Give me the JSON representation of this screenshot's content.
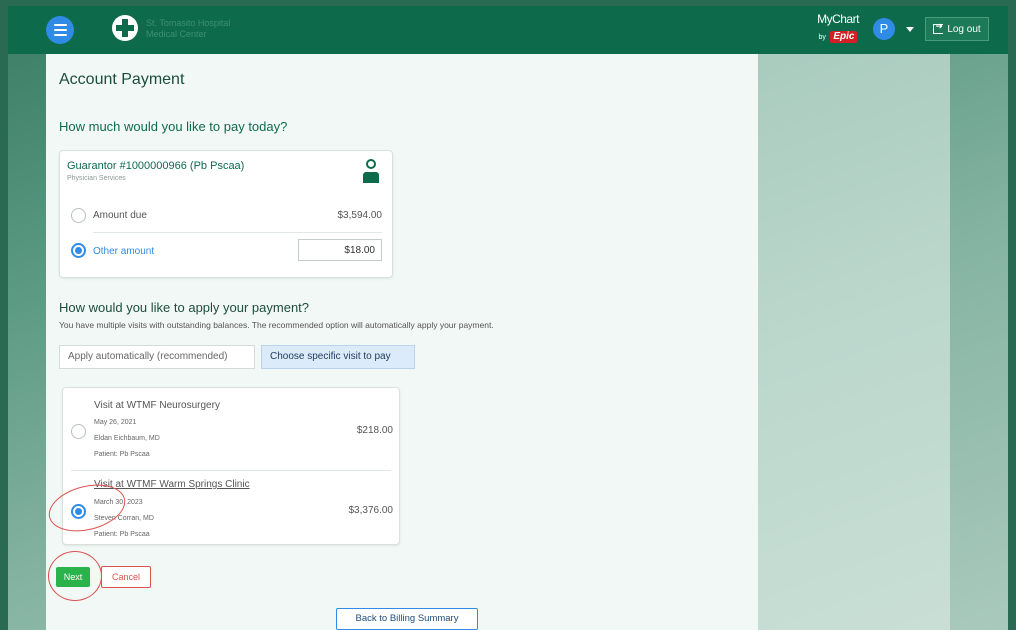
{
  "header": {
    "logo_text_line1": "St. Tomasito Hospital",
    "logo_text_line2": "Medical Center",
    "mychart": "MyChart",
    "by": "by",
    "epic": "Epic",
    "user_initial": "P",
    "logout_label": "Log out"
  },
  "page": {
    "title": "Account Payment",
    "pay_question": "How much would you like to pay today?",
    "apply_question": "How would you like to apply your payment?",
    "apply_description": "You have multiple visits with outstanding balances. The recommended option will automatically apply your payment."
  },
  "guarantor": {
    "title": "Guarantor #1000000966 (Pb Pscaa)",
    "subtitle": "Physician Services",
    "options": [
      {
        "label": "Amount due",
        "amount": "$3,594.00",
        "selected": false
      },
      {
        "label": "Other amount",
        "value": "$18.00",
        "selected": true
      }
    ]
  },
  "apply_tabs": [
    {
      "label": "Apply automatically (recommended)",
      "selected": false
    },
    {
      "label": "Choose specific visit to pay",
      "selected": true
    }
  ],
  "visits": [
    {
      "title": "Visit at WTMF Neurosurgery",
      "date": "May 26, 2021",
      "provider": "Eldan Eichbaum, MD",
      "patient": "Patient: Pb Pscaa",
      "amount": "$218.00",
      "selected": false
    },
    {
      "title": "Visit at WTMF Warm Springs Clinic",
      "date": "March 30, 2023",
      "provider": "Steven Corran, MD",
      "patient": "Patient: Pb Pscaa",
      "amount": "$3,376.00",
      "selected": true
    }
  ],
  "actions": {
    "next": "Next",
    "cancel": "Cancel",
    "back": "Back to Billing Summary"
  },
  "colors": {
    "header": "#0d6b4c",
    "accent": "#2f8be6",
    "next": "#2bb34b",
    "cancel": "#d9534f",
    "annotation": "#d9534f"
  }
}
